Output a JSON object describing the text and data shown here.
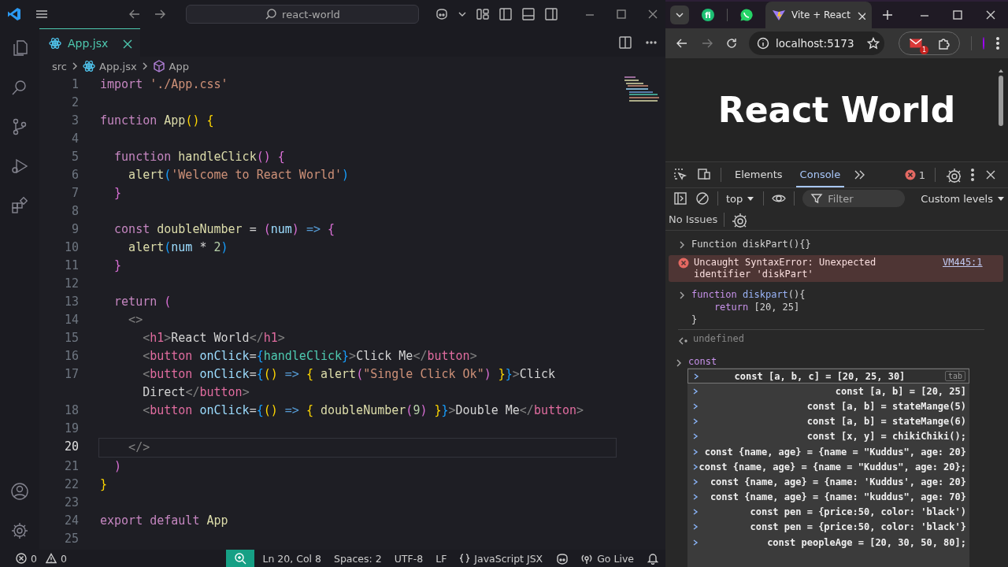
{
  "titlebar": {
    "search": "react-world"
  },
  "editor_tabs": [
    {
      "label": "App.jsx",
      "selected": true
    }
  ],
  "breadcrumbs": [
    "src",
    "App.jsx",
    "App"
  ],
  "code": [
    {
      "n": "1",
      "selected": false,
      "tokens": [
        {
          "text": "import ",
          "kind": "kw"
        },
        {
          "text": "'./App.css'",
          "kind": "str"
        }
      ]
    },
    {
      "n": "2",
      "selected": false
    },
    {
      "n": "3",
      "selected": false,
      "tokens": [
        {
          "text": "function ",
          "kind": "kw"
        },
        {
          "text": "App",
          "kind": "fn"
        },
        {
          "text": "() {",
          "kind": "b1"
        }
      ]
    },
    {
      "n": "4",
      "selected": false
    },
    {
      "n": "5",
      "selected": false,
      "tokens": [
        {
          "text": "  function ",
          "kind": "kw"
        },
        {
          "text": "handleClick",
          "kind": "fn"
        },
        {
          "text": "() {",
          "kind": "b2"
        }
      ]
    },
    {
      "n": "6",
      "selected": false,
      "tokens": [
        {
          "text": "    alert",
          "kind": "fn"
        },
        {
          "text": "(",
          "kind": "b3"
        },
        {
          "text": "'Welcome to React World'",
          "kind": "str"
        },
        {
          "text": ")",
          "kind": "b3"
        }
      ]
    },
    {
      "n": "7",
      "selected": false,
      "tokens": [
        {
          "text": "  }",
          "kind": "b2"
        }
      ]
    },
    {
      "n": "8",
      "selected": false
    },
    {
      "n": "9",
      "selected": false,
      "tokens": [
        {
          "text": "  const ",
          "kind": "kw"
        },
        {
          "text": "doubleNumber",
          "kind": "fn"
        },
        {
          "text": " = ",
          "kind": "op"
        },
        {
          "text": "(",
          "kind": "b2"
        },
        {
          "text": "num",
          "kind": "var"
        },
        {
          "text": ")",
          "kind": "b2"
        },
        {
          "text": " => ",
          "kind": "arrow"
        },
        {
          "text": "{",
          "kind": "b2"
        }
      ]
    },
    {
      "n": "10",
      "selected": false,
      "tokens": [
        {
          "text": "    alert",
          "kind": "fn"
        },
        {
          "text": "(",
          "kind": "b3"
        },
        {
          "text": "num",
          "kind": "var"
        },
        {
          "text": " * ",
          "kind": "op"
        },
        {
          "text": "2",
          "kind": "num"
        },
        {
          "text": ")",
          "kind": "b3"
        }
      ]
    },
    {
      "n": "11",
      "selected": false,
      "tokens": [
        {
          "text": "  }",
          "kind": "b2"
        }
      ]
    },
    {
      "n": "12",
      "selected": false
    },
    {
      "n": "13",
      "selected": false,
      "tokens": [
        {
          "text": "  return ",
          "kind": "kw"
        },
        {
          "text": "(",
          "kind": "b2"
        }
      ]
    },
    {
      "n": "14",
      "selected": false,
      "tokens": [
        {
          "text": "    <>",
          "kind": "punct"
        }
      ]
    },
    {
      "n": "15",
      "selected": false,
      "tokens": [
        {
          "text": "      <",
          "kind": "punct"
        },
        {
          "text": "h1",
          "kind": "tag"
        },
        {
          "text": ">",
          "kind": "punct"
        },
        {
          "text": "React World",
          "kind": "plain"
        },
        {
          "text": "</",
          "kind": "punct"
        },
        {
          "text": "h1",
          "kind": "tag"
        },
        {
          "text": ">",
          "kind": "punct"
        }
      ]
    },
    {
      "n": "16",
      "selected": false,
      "tokens": [
        {
          "text": "      <",
          "kind": "punct"
        },
        {
          "text": "button",
          "kind": "tag"
        },
        {
          "text": " onClick",
          "kind": "attr"
        },
        {
          "text": "=",
          "kind": "op"
        },
        {
          "text": "{",
          "kind": "b3"
        },
        {
          "text": "handleClick",
          "kind": "ref"
        },
        {
          "text": "}",
          "kind": "b3"
        },
        {
          "text": ">",
          "kind": "punct"
        },
        {
          "text": "Click Me",
          "kind": "plain"
        },
        {
          "text": "</",
          "kind": "punct"
        },
        {
          "text": "button",
          "kind": "tag"
        },
        {
          "text": ">",
          "kind": "punct"
        }
      ]
    },
    {
      "n": "17",
      "selected": false,
      "tokens": [
        {
          "text": "      <",
          "kind": "punct"
        },
        {
          "text": "button",
          "kind": "tag"
        },
        {
          "text": " onClick",
          "kind": "attr"
        },
        {
          "text": "=",
          "kind": "op"
        },
        {
          "text": "{",
          "kind": "b3"
        },
        {
          "text": "()",
          "kind": "b1"
        },
        {
          "text": " => ",
          "kind": "arrow"
        },
        {
          "text": "{",
          "kind": "b1"
        },
        {
          "text": " alert",
          "kind": "fn"
        },
        {
          "text": "(",
          "kind": "b2"
        },
        {
          "text": "\"Single Click Ok\"",
          "kind": "str"
        },
        {
          "text": ") ",
          "kind": "b2"
        },
        {
          "text": "}",
          "kind": "b1"
        },
        {
          "text": "}",
          "kind": "b3"
        },
        {
          "text": ">",
          "kind": "punct"
        },
        {
          "text": "Click",
          "kind": "plain"
        }
      ],
      "wrapped": [
        {
          "text": "      Direct",
          "kind": "plain"
        },
        {
          "text": "</",
          "kind": "punct"
        },
        {
          "text": "button",
          "kind": "tag"
        },
        {
          "text": ">",
          "kind": "punct"
        }
      ]
    },
    {
      "n": "18",
      "selected": false,
      "tokens": [
        {
          "text": "      <",
          "kind": "punct"
        },
        {
          "text": "button",
          "kind": "tag"
        },
        {
          "text": " onClick",
          "kind": "attr"
        },
        {
          "text": "=",
          "kind": "op"
        },
        {
          "text": "{",
          "kind": "b3"
        },
        {
          "text": "()",
          "kind": "b1"
        },
        {
          "text": " => ",
          "kind": "arrow"
        },
        {
          "text": "{",
          "kind": "b1"
        },
        {
          "text": " doubleNumber",
          "kind": "fn"
        },
        {
          "text": "(",
          "kind": "b2"
        },
        {
          "text": "9",
          "kind": "num"
        },
        {
          "text": ") ",
          "kind": "b2"
        },
        {
          "text": "}",
          "kind": "b1"
        },
        {
          "text": "}",
          "kind": "b3"
        },
        {
          "text": ">",
          "kind": "punct"
        },
        {
          "text": "Double Me",
          "kind": "plain"
        },
        {
          "text": "</",
          "kind": "punct"
        },
        {
          "text": "button",
          "kind": "tag"
        },
        {
          "text": ">",
          "kind": "punct"
        }
      ]
    },
    {
      "n": "19",
      "selected": false
    },
    {
      "n": "20",
      "selected": true,
      "tokens": [
        {
          "text": "    </>",
          "kind": "punct"
        }
      ]
    },
    {
      "n": "21",
      "selected": false,
      "tokens": [
        {
          "text": "  )",
          "kind": "b2"
        }
      ]
    },
    {
      "n": "22",
      "selected": false,
      "tokens": [
        {
          "text": "}",
          "kind": "b1"
        }
      ]
    },
    {
      "n": "23",
      "selected": false
    },
    {
      "n": "24",
      "selected": false,
      "tokens": [
        {
          "text": "export default ",
          "kind": "kw"
        },
        {
          "text": "App",
          "kind": "fn"
        }
      ]
    },
    {
      "n": "25",
      "selected": false
    }
  ],
  "status_bar": {
    "errors": "0",
    "warnings": "0",
    "position": "Ln 20, Col 8",
    "spaces": "Spaces: 2",
    "encoding": "UTF-8",
    "eol": "LF",
    "language": "JavaScript JSX",
    "live": "Go Live"
  },
  "browser": {
    "pinned_tab": "fi",
    "tabs": [
      {
        "label": "Vite + React",
        "selected": true
      }
    ],
    "address": "localhost:5173",
    "extension_badge": "1",
    "page_heading": "React World"
  },
  "devtools": {
    "tabs": [
      {
        "label": "Elements",
        "selected": false
      },
      {
        "label": "Console",
        "selected": true
      }
    ],
    "error_count": "1",
    "context": "top",
    "filter_placeholder": "Filter",
    "levels": "Custom levels",
    "issues": "No Issues",
    "console": [
      {
        "kind": "input",
        "lines": [
          [
            {
              "text": "Function diskPart(){}",
              "kind": "plain"
            }
          ]
        ]
      },
      {
        "kind": "error",
        "text": "Uncaught SyntaxError: Unexpected identifier 'diskPart'",
        "source": "VM445:1"
      },
      {
        "kind": "input",
        "lines": [
          [
            {
              "text": "function ",
              "kind": "kw"
            },
            {
              "text": "diskpart",
              "kind": "fn"
            },
            {
              "text": "(){",
              "kind": "plain"
            }
          ],
          [
            {
              "text": "    return ",
              "kind": "kw"
            },
            {
              "text": "[20, 25]",
              "kind": "plain"
            }
          ],
          [
            {
              "text": "}",
              "kind": "plain"
            }
          ]
        ]
      },
      {
        "kind": "result",
        "text": "undefined"
      }
    ],
    "prompt": "const",
    "suggestions": [
      {
        "text": "const [a, b, c] = [20, 25, 30]",
        "selected": true,
        "hint": "tab"
      },
      {
        "text": "const [a, b] = [20, 25]",
        "selected": false
      },
      {
        "text": "const [a, b] = stateMange(5)",
        "selected": false
      },
      {
        "text": "const [a, b] = stateMange(6)",
        "selected": false
      },
      {
        "text": "const [x, y] = chikiChiki();",
        "selected": false
      },
      {
        "text": "const {name, age} = {name = \"Kuddus\", age: 20}",
        "selected": false
      },
      {
        "text": "const {name, age} = {name = \"Kuddus\", age: 20};",
        "selected": false
      },
      {
        "text": "const {name, age} = {name: 'Kuddus', age: 20}",
        "selected": false
      },
      {
        "text": "const {name, age} = {name: \"kuddus\", age: 70}",
        "selected": false
      },
      {
        "text": "const pen = {price:50, color: 'black')",
        "selected": false
      },
      {
        "text": "const pen = {price:50, color: 'black'}",
        "selected": false
      },
      {
        "text": "const peopleAge = [20, 30, 50, 80];",
        "selected": false
      }
    ]
  }
}
